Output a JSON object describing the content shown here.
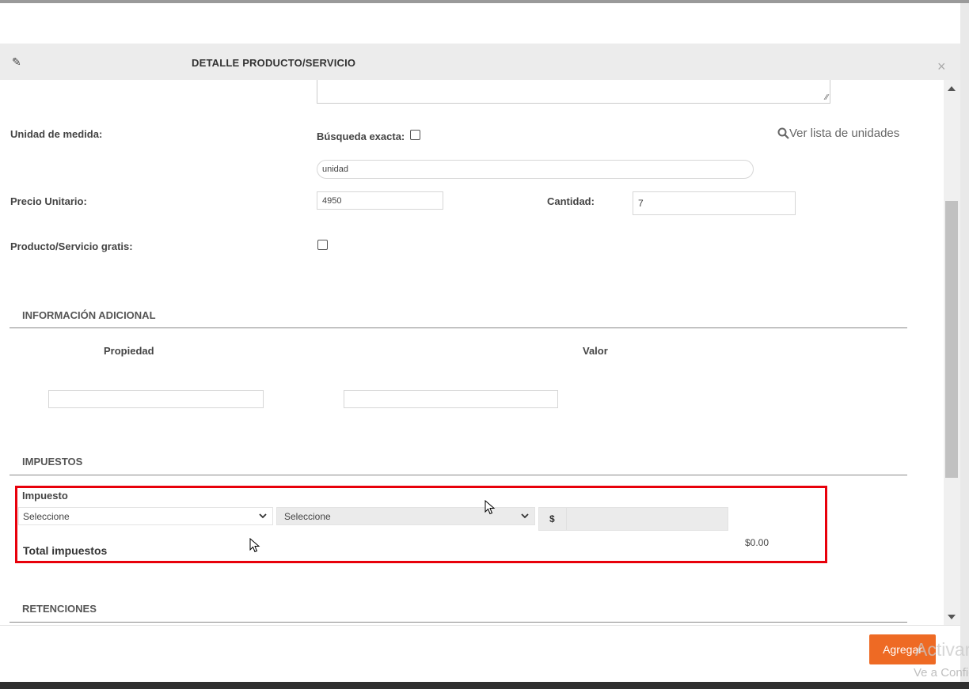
{
  "modal": {
    "title": "DETALLE PRODUCTO/SERVICIO",
    "icons": {
      "edit": "pencil-icon",
      "close": "close-icon"
    }
  },
  "form": {
    "unidad_medida_label": "Unidad de medida:",
    "busqueda_exacta_label": "Búsqueda exacta:",
    "ver_lista_label": "Ver lista de unidades",
    "unidad_value": "unidad",
    "precio_unitario_label": "Precio Unitario:",
    "precio_unitario_value": "4950",
    "cantidad_label": "Cantidad:",
    "cantidad_value": "7",
    "gratis_label": "Producto/Servicio gratis:"
  },
  "info_adicional": {
    "title": "INFORMACIÓN ADICIONAL",
    "col_propiedad": "Propiedad",
    "col_valor": "Valor"
  },
  "impuestos": {
    "title": "IMPUESTOS",
    "impuesto_label": "Impuesto",
    "select1": "Seleccione",
    "select2": "Seleccione",
    "currency": "$",
    "total_label": "Total impuestos",
    "total_value": "$0.00"
  },
  "retenciones": {
    "title": "RETENCIONES"
  },
  "footer": {
    "agregar_label": "Agregar"
  },
  "watermark": {
    "line1": "Activar",
    "line2": "Ve a Configuración"
  },
  "colors": {
    "accent": "#ee6a24",
    "highlight": "#e8000b"
  }
}
